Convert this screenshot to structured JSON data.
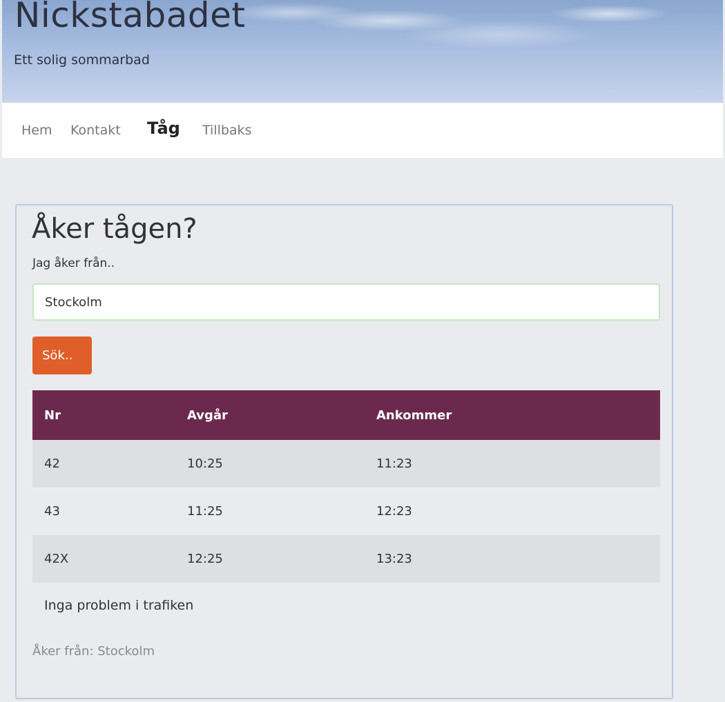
{
  "header": {
    "title": "Nickstabadet",
    "subtitle": "Ett solig sommarbad"
  },
  "nav": {
    "items": [
      {
        "label": "Hem",
        "active": false
      },
      {
        "label": "Kontakt",
        "active": false
      },
      {
        "label": "Tåg",
        "active": true
      },
      {
        "label": "Tillbaks",
        "active": false
      }
    ]
  },
  "train_search": {
    "title": "Åker tågen?",
    "from_label": "Jag åker från..",
    "from_value": "Stockolm",
    "search_button_label": "Sök..",
    "table": {
      "headers": [
        "Nr",
        "Avgår",
        "Ankommer"
      ],
      "rows": [
        [
          "42",
          "10:25",
          "11:23"
        ],
        [
          "43",
          "11:25",
          "12:23"
        ],
        [
          "42X",
          "12:25",
          "13:23"
        ]
      ]
    },
    "traffic_status": "Inga problem i trafiken",
    "from_summary": "Åker från: Stockolm"
  },
  "colors": {
    "accent_button": "#e05e2a",
    "table_header": "#6b2a4d",
    "input_border": "#c4e8be"
  }
}
